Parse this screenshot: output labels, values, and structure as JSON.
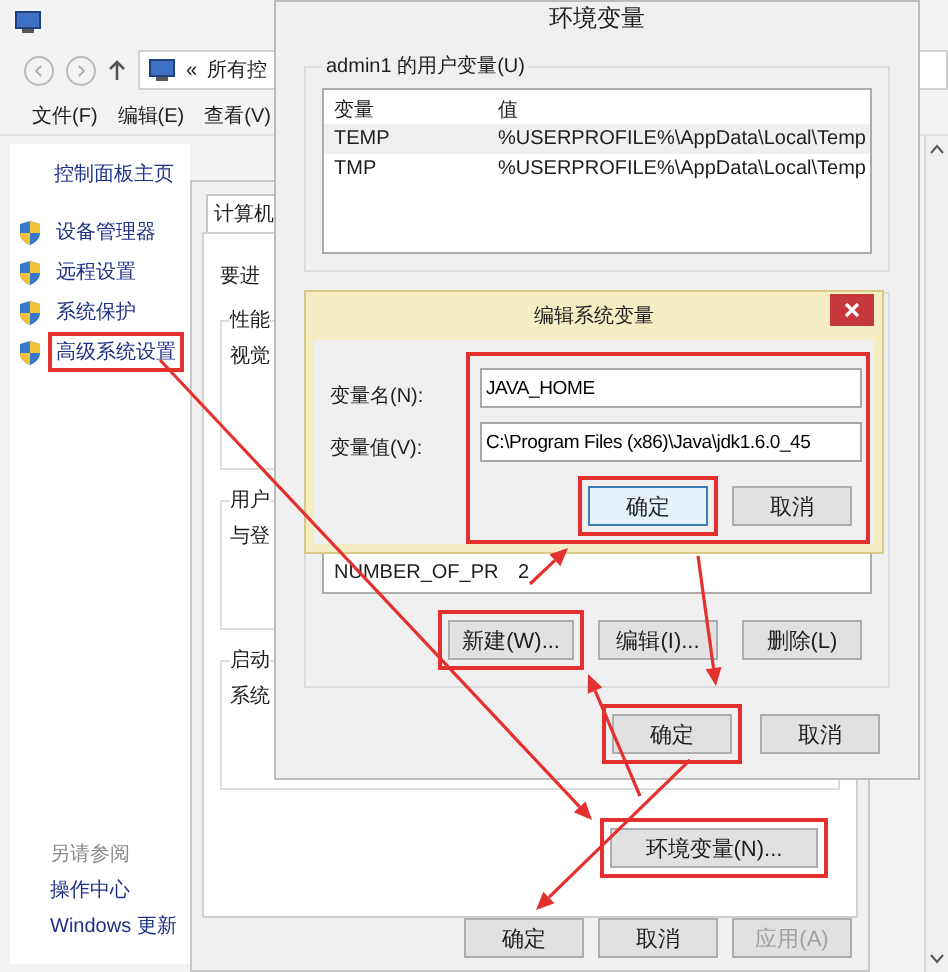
{
  "control_panel": {
    "address_prefix": "«",
    "address": "所有控",
    "menu": [
      "文件(F)",
      "编辑(E)",
      "查看(V)"
    ],
    "home_link": "控制面板主页",
    "tasks": [
      {
        "label": "设备管理器",
        "highlighted": false
      },
      {
        "label": "远程设置",
        "highlighted": false
      },
      {
        "label": "系统保护",
        "highlighted": false
      },
      {
        "label": "高级系统设置",
        "highlighted": true
      }
    ],
    "see_also_title": "另请参阅",
    "see_also": [
      "操作中心",
      "Windows 更新"
    ]
  },
  "system_properties": {
    "tab": "计算机",
    "intro": "要进",
    "groups": [
      {
        "title": "性能",
        "text": "视觉"
      },
      {
        "title": "用户",
        "text": "与登"
      },
      {
        "title": "启动",
        "text": "系统"
      }
    ],
    "env_button": {
      "label": "环境变量(N)...",
      "highlighted": true
    },
    "buttons": [
      {
        "label": "确定",
        "disabled": false
      },
      {
        "label": "取消",
        "disabled": false
      },
      {
        "label": "应用(A)",
        "disabled": true
      }
    ]
  },
  "env_vars": {
    "title": "环境变量",
    "user_group": "admin1 的用户变量(U)",
    "columns": [
      "变量",
      "值"
    ],
    "user_rows": [
      {
        "name": "TEMP",
        "value": "%USERPROFILE%\\AppData\\Local\\Temp",
        "selected": true
      },
      {
        "name": "TMP",
        "value": "%USERPROFILE%\\AppData\\Local\\Temp",
        "selected": false
      }
    ],
    "system_rows": [
      {
        "name": "NUMBER_OF_PR",
        "value": "2"
      }
    ],
    "system_buttons": [
      {
        "label": "新建(W)...",
        "highlighted": true
      },
      {
        "label": "编辑(I)...",
        "highlighted": false
      },
      {
        "label": "删除(L)",
        "highlighted": false
      }
    ],
    "buttons": [
      {
        "label": "确定",
        "highlighted": true
      },
      {
        "label": "取消",
        "highlighted": false
      }
    ]
  },
  "edit_dialog": {
    "title": "编辑系统变量",
    "highlighted": true,
    "fields": [
      {
        "label": "变量名(N):",
        "value": "JAVA_HOME"
      },
      {
        "label": "变量值(V):",
        "value": "C:\\Program Files (x86)\\Java\\jdk1.6.0_45"
      }
    ],
    "buttons": [
      {
        "label": "确定",
        "focused": true,
        "highlighted": true
      },
      {
        "label": "取消",
        "focused": false,
        "highlighted": false
      }
    ]
  }
}
